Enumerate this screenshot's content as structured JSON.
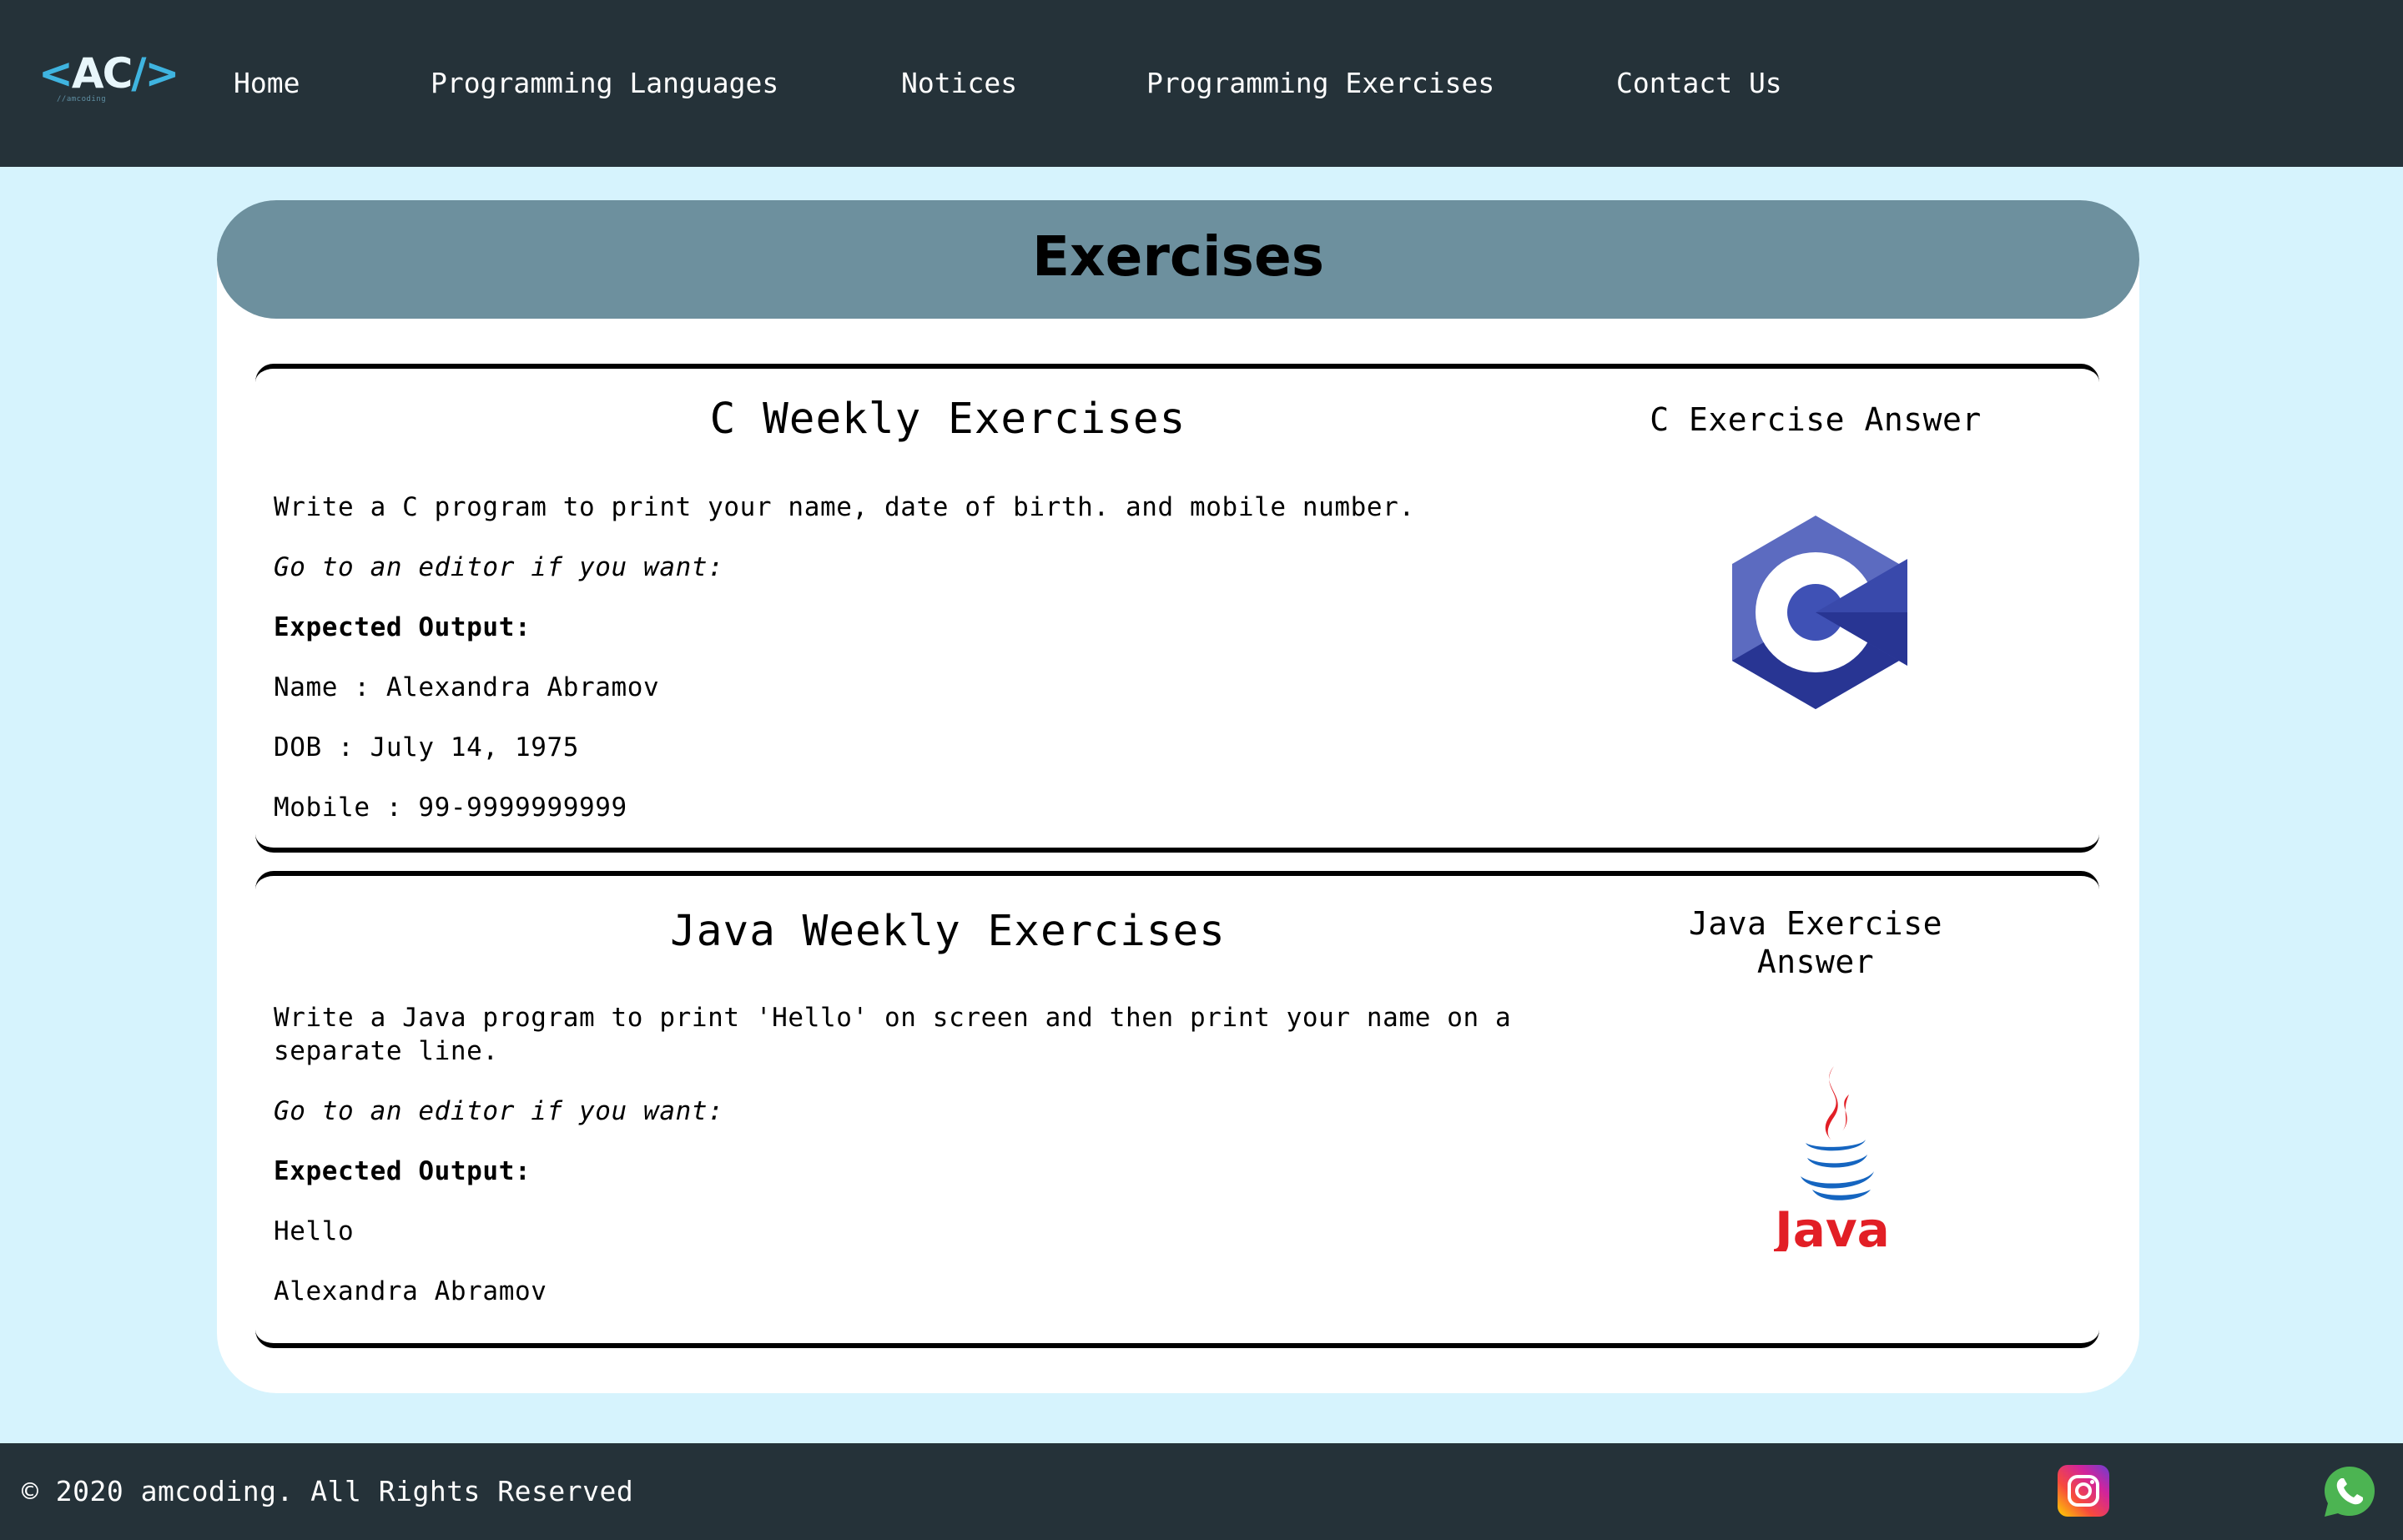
{
  "nav": {
    "logo_main": "AC",
    "logo_open": "<",
    "logo_close": "/>",
    "logo_sub": "//amcoding",
    "links": [
      "Home",
      "Programming Languages",
      "Notices",
      "Programming Exercises",
      "Contact Us"
    ]
  },
  "page": {
    "title": "Exercises"
  },
  "exercises": [
    {
      "heading": "C Weekly Exercises",
      "prompt": "Write a C program to print your name, date of birth. and mobile number.",
      "editor_hint": "Go to an editor if you want:",
      "expected_label": "Expected Output:",
      "output_lines": [
        "Name : Alexandra Abramov",
        "DOB : July 14, 1975",
        "Mobile : 99-9999999999"
      ],
      "answer_title": "C Exercise Answer",
      "answer_icon": "c-language-logo-icon"
    },
    {
      "heading": "Java Weekly Exercises",
      "prompt": "Write a Java program to print 'Hello' on screen and then print your name on a separate line.",
      "editor_hint": "Go to an editor if you want:",
      "expected_label": "Expected Output:",
      "output_lines": [
        "Hello",
        "Alexandra Abramov"
      ],
      "answer_title_lines": [
        "Java Exercise",
        "Answer"
      ],
      "answer_icon": "java-logo-icon",
      "java_wordmark": "Java"
    }
  ],
  "footer": {
    "copyright": "© 2020 amcoding. All Rights Reserved",
    "icons": [
      "instagram-icon",
      "whatsapp-icon"
    ]
  },
  "colors": {
    "nav_bg": "#253239",
    "page_bg": "#d6f3fd",
    "header_bar": "#6d909e",
    "c_logo_light": "#5c6bc0",
    "c_logo_dark": "#283593",
    "java_red": "#e21f26",
    "java_blue": "#1565c0"
  }
}
